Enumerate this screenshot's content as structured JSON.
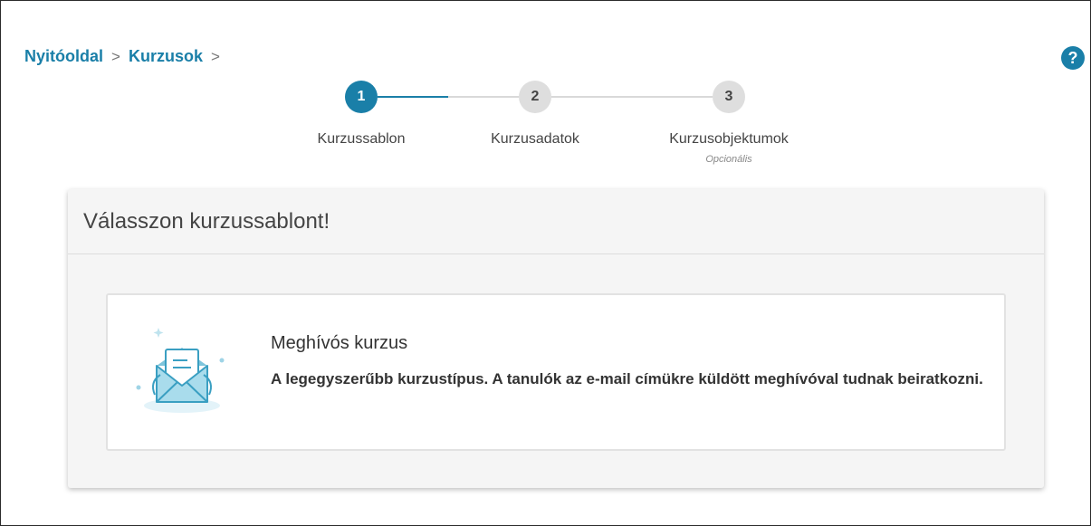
{
  "breadcrumb": {
    "items": [
      "Nyitóoldal",
      "Kurzusok"
    ],
    "separator": ">"
  },
  "help": {
    "label": "?"
  },
  "stepper": {
    "steps": [
      {
        "number": "1",
        "label": "Kurzussablon",
        "sub": ""
      },
      {
        "number": "2",
        "label": "Kurzusadatok",
        "sub": ""
      },
      {
        "number": "3",
        "label": "Kurzusobjektumok",
        "sub": "Opcionális"
      }
    ],
    "active_step": 1
  },
  "panel": {
    "heading": "Válasszon kurzussablont!",
    "card": {
      "icon": "envelope-icon",
      "title": "Meghívós kurzus",
      "description": "A legegyszerűbb kurzustípus. A tanulók az e-mail címükre küldött meghívóval tudnak beiratkozni."
    }
  },
  "colors": {
    "accent": "#1a7fa8",
    "inactive_step": "#dedede",
    "panel_bg": "#f5f5f5"
  }
}
